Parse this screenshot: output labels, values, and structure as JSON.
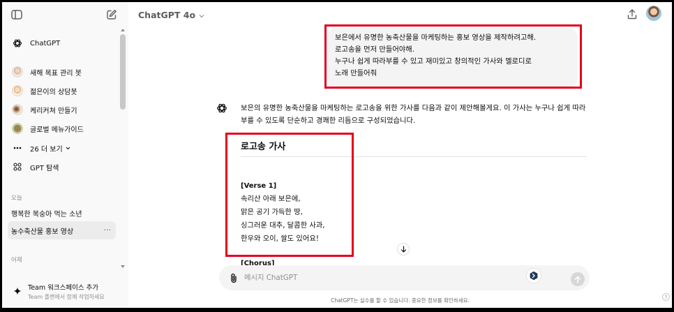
{
  "sidebar": {
    "top_items": [
      {
        "label": "ChatGPT",
        "icon": "openai-icon"
      },
      {
        "label": "새해 목표 관리 봇",
        "icon": "avatar"
      },
      {
        "label": "젊은이의 상담봇",
        "icon": "avatar"
      },
      {
        "label": "케리커쳐 만들기",
        "icon": "avatar"
      },
      {
        "label": "글로벌 메뉴가이드",
        "icon": "avatar"
      },
      {
        "label": "26 더 보기",
        "icon": "ellipsis-icon"
      },
      {
        "label": "GPT 탐색",
        "icon": "grid-icon"
      }
    ],
    "sections": {
      "today": "오늘",
      "yesterday": "어제"
    },
    "today_items": [
      "행복한 복숭아 먹는 소년",
      "농수축산물 홍보 영상"
    ],
    "team": {
      "title": "Team 워크스페이스 추가",
      "subtitle": "Team 플랜에서 함께 작업하세요"
    }
  },
  "header": {
    "model": "ChatGPT 4o"
  },
  "conversation": {
    "user_lines": [
      "보은에서 유명한 농축산물을 마케팅하는 홍보 영상을 제작하려고해.",
      "로고송을 먼저 만들어야해.",
      "누구나 쉽게 따라부를 수 있고 재미있고 창의적인 가사와 멜로디로",
      "노래 만들어줘"
    ],
    "assistant_intro": "보은의 유명한 농축산물을 마케팅하는 로고송을 위한 가사를 다음과 같이 제안해볼게요. 이 가사는 누구나 쉽게 따라 부를 수 있도록 단순하고 경쾌한 리듬으로 구성되었습니다.",
    "lyrics_heading": "로고송 가사",
    "verse_label": "[Verse 1]",
    "verse_lines": [
      "속리산 아래 보은에,",
      "맑은 공기 가득한 땅,",
      "싱그러운 대추, 달콤한 사과,",
      "한우와 오이, 쌀도 있어요!"
    ],
    "chorus_label": "[Chorus]"
  },
  "composer": {
    "placeholder": "메시지 ChatGPT"
  },
  "footer": {
    "disclaimer": "ChatGPT는 실수를 할 수 있습니다. 중요한 정보를 확인하세요.",
    "help": "?"
  },
  "colors": {
    "highlight": "#e3001b",
    "sidebar_bg": "#f9f9f9",
    "bubble_bg": "#f4f4f4"
  }
}
